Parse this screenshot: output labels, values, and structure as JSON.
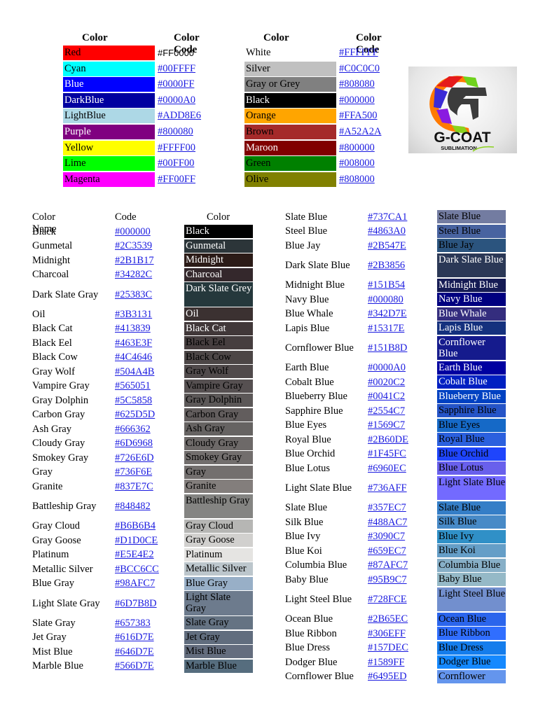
{
  "top_table": {
    "headers": {
      "name": "Color Name",
      "code": "Color Code"
    },
    "left": [
      {
        "name": "Red",
        "code": "#FF0000",
        "bg": "#FF0000",
        "fg": "#000000",
        "link": false
      },
      {
        "name": "Cyan",
        "code": "#00FFFF",
        "bg": "#00FFFF",
        "fg": "#000000",
        "link": true
      },
      {
        "name": "Blue",
        "code": "#0000FF",
        "bg": "#0000FF",
        "fg": "#ffffff",
        "link": true
      },
      {
        "name": "DarkBlue",
        "code": "#0000A0",
        "bg": "#0000A0",
        "fg": "#ffffff",
        "link": true
      },
      {
        "name": "LightBlue",
        "code": "#ADD8E6",
        "bg": "#ADD8E6",
        "fg": "#000000",
        "link": true
      },
      {
        "name": "Purple",
        "code": "#800080",
        "bg": "#800080",
        "fg": "#ffffff",
        "link": true
      },
      {
        "name": "Yellow",
        "code": "#FFFF00",
        "bg": "#FFFF00",
        "fg": "#000000",
        "link": true
      },
      {
        "name": "Lime",
        "code": "#00FF00",
        "bg": "#00FF00",
        "fg": "#000000",
        "link": true
      },
      {
        "name": "Magenta",
        "code": "#FF00FF",
        "bg": "#FF00FF",
        "fg": "#000000",
        "link": true
      }
    ],
    "right": [
      {
        "name": "White",
        "code": "#FFFFFF",
        "bg": "#FFFFFF",
        "fg": "#000000",
        "link": true
      },
      {
        "name": "Silver",
        "code": "#C0C0C0",
        "bg": "#C0C0C0",
        "fg": "#000000",
        "link": true
      },
      {
        "name": "Gray or Grey",
        "code": "#808080",
        "bg": "#808080",
        "fg": "#000000",
        "link": true
      },
      {
        "name": "Black",
        "code": "#000000",
        "bg": "#000000",
        "fg": "#ffffff",
        "link": true
      },
      {
        "name": "Orange",
        "code": "#FFA500",
        "bg": "#FFA500",
        "fg": "#000000",
        "link": true
      },
      {
        "name": "Brown",
        "code": "#A52A2A",
        "bg": "#A52A2A",
        "fg": "#000000",
        "link": true
      },
      {
        "name": "Maroon",
        "code": "#800000",
        "bg": "#800000",
        "fg": "#ffffff",
        "link": true
      },
      {
        "name": "Green",
        "code": "#008000",
        "bg": "#008000",
        "fg": "#000000",
        "link": true
      },
      {
        "name": "Olive",
        "code": "#808000",
        "bg": "#808000",
        "fg": "#000000",
        "link": true
      }
    ]
  },
  "logo": {
    "title": "G-COAT",
    "subtitle": "SUBLIMATION"
  },
  "gray_table": {
    "headers": {
      "name": "Color Name",
      "code": "Code",
      "color": "Color"
    },
    "rows": [
      {
        "name": "Black",
        "code": "#000000",
        "swatch": "Black",
        "bg": "#000000",
        "fg": "#ffffff"
      },
      {
        "name": "Gunmetal",
        "code": "#2C3539",
        "swatch": "Gunmetal",
        "bg": "#2C3539",
        "fg": "#ffffff"
      },
      {
        "name": "Midnight",
        "code": "#2B1B17",
        "swatch": "Midnight",
        "bg": "#2B1B17",
        "fg": "#ffffff"
      },
      {
        "name": "Charcoal",
        "code": "#34282C",
        "swatch": "Charcoal",
        "bg": "#34282C",
        "fg": "#ffffff"
      },
      {
        "name": "Dark Slate Gray",
        "code": "#25383C",
        "swatch": "Dark Slate Grey",
        "bg": "#25383C",
        "fg": "#ffffff",
        "tall": true
      },
      {
        "name": "Oil",
        "code": "#3B3131",
        "swatch": "Oil",
        "bg": "#3B3131",
        "fg": "#ffffff"
      },
      {
        "name": "Black Cat",
        "code": "#413839",
        "swatch": "Black Cat",
        "bg": "#413839",
        "fg": "#ffffff"
      },
      {
        "name": "Black Eel",
        "code": "#463E3F",
        "swatch": "Black Eel",
        "bg": "#463E3F",
        "fg": "#000000"
      },
      {
        "name": "Black Cow",
        "code": "#4C4646",
        "swatch": "Black Cow",
        "bg": "#4C4646",
        "fg": "#000000"
      },
      {
        "name": "Gray Wolf",
        "code": "#504A4B",
        "swatch": "Gray Wolf",
        "bg": "#504A4B",
        "fg": "#000000"
      },
      {
        "name": "Vampire Gray",
        "code": "#565051",
        "swatch": "Vampire Gray",
        "bg": "#565051",
        "fg": "#000000"
      },
      {
        "name": "Gray Dolphin",
        "code": "#5C5858",
        "swatch": "Gray Dolphin",
        "bg": "#5C5858",
        "fg": "#000000"
      },
      {
        "name": "Carbon Gray",
        "code": "#625D5D",
        "swatch": "Carbon Gray",
        "bg": "#625D5D",
        "fg": "#000000"
      },
      {
        "name": "Ash Gray",
        "code": "#666362",
        "swatch": "Ash Gray",
        "bg": "#666362",
        "fg": "#000000"
      },
      {
        "name": "Cloudy Gray",
        "code": "#6D6968",
        "swatch": "Cloudy Gray",
        "bg": "#6D6968",
        "fg": "#000000"
      },
      {
        "name": "Smokey Gray",
        "code": "#726E6D",
        "swatch": "Smokey Gray",
        "bg": "#726E6D",
        "fg": "#000000"
      },
      {
        "name": "Gray",
        "code": "#736F6E",
        "swatch": "Gray",
        "bg": "#736F6E",
        "fg": "#000000"
      },
      {
        "name": "Granite",
        "code": "#837E7C",
        "swatch": "Granite",
        "bg": "#837E7C",
        "fg": "#000000"
      },
      {
        "name": "Battleship Gray",
        "code": "#848482",
        "swatch": "Battleship Gray",
        "bg": "#848482",
        "fg": "#000000",
        "tall": true
      },
      {
        "name": "Gray Cloud",
        "code": "#B6B6B4",
        "swatch": "Gray Cloud",
        "bg": "#B6B6B4",
        "fg": "#000000"
      },
      {
        "name": "Gray Goose",
        "code": "#D1D0CE",
        "swatch": "Gray Goose",
        "bg": "#D1D0CE",
        "fg": "#000000"
      },
      {
        "name": "Platinum",
        "code": "#E5E4E2",
        "swatch": "Platinum",
        "bg": "#E5E4E2",
        "fg": "#000000"
      },
      {
        "name": "Metallic Silver",
        "code": "#BCC6CC",
        "swatch": "Metallic Silver",
        "bg": "#BCC6CC",
        "fg": "#000000"
      },
      {
        "name": "Blue Gray",
        "code": "#98AFC7",
        "swatch": "Blue Gray",
        "bg": "#98AFC7",
        "fg": "#000000"
      },
      {
        "name": "Light Slate Gray",
        "code": "#6D7B8D",
        "swatch": "Light Slate Gray",
        "bg": "#6D7B8D",
        "fg": "#000000",
        "tall": true
      },
      {
        "name": "Slate Gray",
        "code": "#657383",
        "swatch": "Slate Gray",
        "bg": "#657383",
        "fg": "#000000"
      },
      {
        "name": "Jet Gray",
        "code": "#616D7E",
        "swatch": "Jet Gray",
        "bg": "#616D7E",
        "fg": "#000000"
      },
      {
        "name": "Mist Blue",
        "code": "#646D7E",
        "swatch": "Mist Blue",
        "bg": "#646D7E",
        "fg": "#000000"
      },
      {
        "name": "Marble Blue",
        "code": "#566D7E",
        "swatch": "Marble Blue",
        "bg": "#566D7E",
        "fg": "#000000"
      }
    ]
  },
  "blue_table": {
    "rows": [
      {
        "name": "Slate Blue",
        "code": "#737CA1",
        "swatch": "Slate Blue",
        "bg": "#737CA1",
        "fg": "#000000"
      },
      {
        "name": "Steel Blue",
        "code": "#4863A0",
        "swatch": "Steel Blue",
        "bg": "#4863A0",
        "fg": "#000000"
      },
      {
        "name": "Blue Jay",
        "code": "#2B547E",
        "swatch": "Blue Jay",
        "bg": "#2B547E",
        "fg": "#000000"
      },
      {
        "name": "Dark Slate Blue",
        "code": "#2B3856",
        "swatch": "Dark Slate Blue",
        "bg": "#2B3856",
        "fg": "#ffffff",
        "tall": true
      },
      {
        "name": "Midnight Blue",
        "code": "#151B54",
        "swatch": "Midnight Blue",
        "bg": "#151B54",
        "fg": "#ffffff"
      },
      {
        "name": "Navy Blue",
        "code": "#000080",
        "swatch": "Navy Blue",
        "bg": "#000080",
        "fg": "#ffffff"
      },
      {
        "name": "Blue Whale",
        "code": "#342D7E",
        "swatch": "Blue Whale",
        "bg": "#342D7E",
        "fg": "#ffffff"
      },
      {
        "name": "Lapis Blue",
        "code": "#15317E",
        "swatch": "Lapis Blue",
        "bg": "#15317E",
        "fg": "#ffffff"
      },
      {
        "name": "Cornflower Blue",
        "code": "#151B8D",
        "swatch": "Cornflower Blue",
        "bg": "#151B8D",
        "fg": "#ffffff",
        "tall": true
      },
      {
        "name": "Earth Blue",
        "code": "#0000A0",
        "swatch": "Earth Blue",
        "bg": "#0000A0",
        "fg": "#ffffff"
      },
      {
        "name": "Cobalt Blue",
        "code": "#0020C2",
        "swatch": "Cobalt Blue",
        "bg": "#0020C2",
        "fg": "#ffffff"
      },
      {
        "name": "Blueberry Blue",
        "code": "#0041C2",
        "swatch": "Blueberry Blue",
        "bg": "#0041C2",
        "fg": "#ffffff"
      },
      {
        "name": "Sapphire Blue",
        "code": "#2554C7",
        "swatch": "Sapphire Blue",
        "bg": "#2554C7",
        "fg": "#000000"
      },
      {
        "name": "Blue Eyes",
        "code": "#1569C7",
        "swatch": "Blue Eyes",
        "bg": "#1569C7",
        "fg": "#000000"
      },
      {
        "name": "Royal Blue",
        "code": "#2B60DE",
        "swatch": "Royal Blue",
        "bg": "#2B60DE",
        "fg": "#000000"
      },
      {
        "name": "Blue Orchid",
        "code": "#1F45FC",
        "swatch": "Blue Orchid",
        "bg": "#1F45FC",
        "fg": "#000000"
      },
      {
        "name": "Blue Lotus",
        "code": "#6960EC",
        "swatch": "Blue Lotus",
        "bg": "#6960EC",
        "fg": "#000000"
      },
      {
        "name": "Light Slate Blue",
        "code": "#736AFF",
        "swatch": "Light Slate Blue",
        "bg": "#736AFF",
        "fg": "#000000",
        "tall": true
      },
      {
        "name": "Slate Blue",
        "code": "#357EC7",
        "swatch": "Slate Blue",
        "bg": "#357EC7",
        "fg": "#000000"
      },
      {
        "name": "Silk Blue",
        "code": "#488AC7",
        "swatch": "Silk Blue",
        "bg": "#488AC7",
        "fg": "#000000"
      },
      {
        "name": "Blue Ivy",
        "code": "#3090C7",
        "swatch": "Blue Ivy",
        "bg": "#3090C7",
        "fg": "#000000"
      },
      {
        "name": "Blue Koi",
        "code": "#659EC7",
        "swatch": "Blue Koi",
        "bg": "#659EC7",
        "fg": "#000000"
      },
      {
        "name": "Columbia Blue",
        "code": "#87AFC7",
        "swatch": "Columbia Blue",
        "bg": "#87AFC7",
        "fg": "#000000"
      },
      {
        "name": "Baby Blue",
        "code": "#95B9C7",
        "swatch": "Baby Blue",
        "bg": "#95B9C7",
        "fg": "#000000"
      },
      {
        "name": "Light Steel Blue",
        "code": "#728FCE",
        "swatch": "Light Steel Blue",
        "bg": "#728FCE",
        "fg": "#000000",
        "tall": true
      },
      {
        "name": "Ocean Blue",
        "code": "#2B65EC",
        "swatch": "Ocean Blue",
        "bg": "#2B65EC",
        "fg": "#000000"
      },
      {
        "name": "Blue Ribbon",
        "code": "#306EFF",
        "swatch": "Blue Ribbon",
        "bg": "#306EFF",
        "fg": "#000000"
      },
      {
        "name": "Blue Dress",
        "code": "#157DEC",
        "swatch": "Blue Dress",
        "bg": "#157DEC",
        "fg": "#000000"
      },
      {
        "name": "Dodger Blue",
        "code": "#1589FF",
        "swatch": "Dodger Blue",
        "bg": "#1589FF",
        "fg": "#000000"
      },
      {
        "name": "Cornflower Blue",
        "code": "#6495ED",
        "swatch": "Cornflower",
        "bg": "#6495ED",
        "fg": "#000000"
      }
    ]
  }
}
